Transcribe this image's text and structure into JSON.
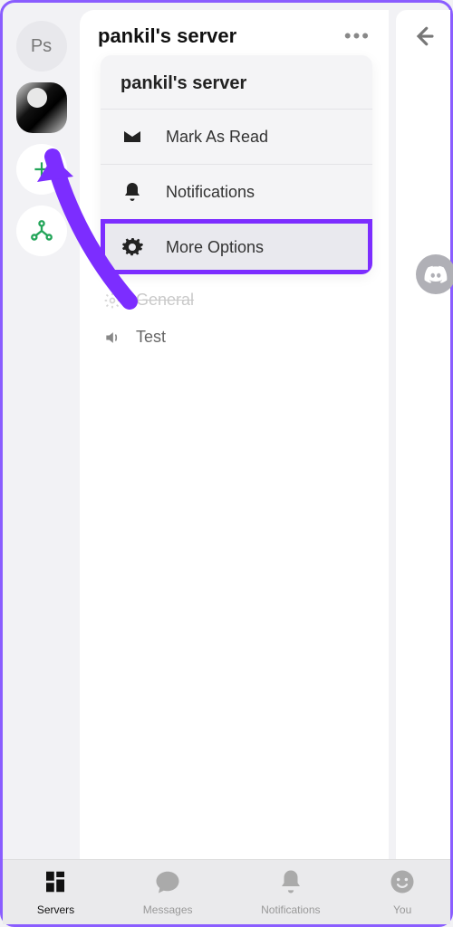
{
  "rail": {
    "initials": "Ps"
  },
  "header": {
    "title": "pankil's server"
  },
  "popover": {
    "title": "pankil's server",
    "mark_read": "Mark As Read",
    "notifications": "Notifications",
    "more_options": "More Options"
  },
  "channels": {
    "general": "General",
    "test": "Test"
  },
  "nav": {
    "servers": "Servers",
    "messages": "Messages",
    "notifications": "Notifications",
    "you": "You"
  }
}
